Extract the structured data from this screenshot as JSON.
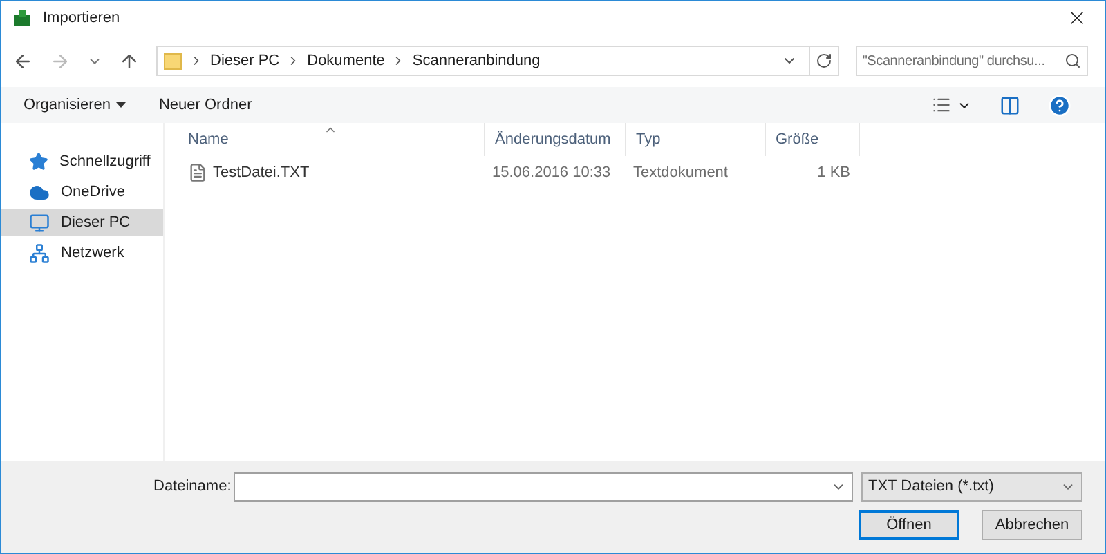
{
  "window": {
    "title": "Importieren"
  },
  "address": {
    "crumbs": [
      "Dieser PC",
      "Dokumente",
      "Scanneranbindung"
    ]
  },
  "search": {
    "placeholder": "\"Scanneranbindung\" durchsu..."
  },
  "toolbar": {
    "organize": "Organisieren",
    "new_folder": "Neuer Ordner"
  },
  "sidebar": {
    "items": [
      {
        "label": "Schnellzugriff",
        "kind": "star",
        "selected": false
      },
      {
        "label": "OneDrive",
        "kind": "cloud",
        "selected": false
      },
      {
        "label": "Dieser PC",
        "kind": "pc",
        "selected": true
      },
      {
        "label": "Netzwerk",
        "kind": "network",
        "selected": false
      }
    ]
  },
  "table": {
    "columns": [
      "Name",
      "Änderungsdatum",
      "Typ",
      "Größe"
    ],
    "rows": [
      {
        "name": "TestDatei.TXT",
        "date": "15.06.2016 10:33",
        "type": "Textdokument",
        "size": "1 KB"
      }
    ]
  },
  "footer": {
    "filename_label": "Dateiname:",
    "filter": "TXT Dateien (*.txt)",
    "open": "Öffnen",
    "cancel": "Abbrechen"
  }
}
